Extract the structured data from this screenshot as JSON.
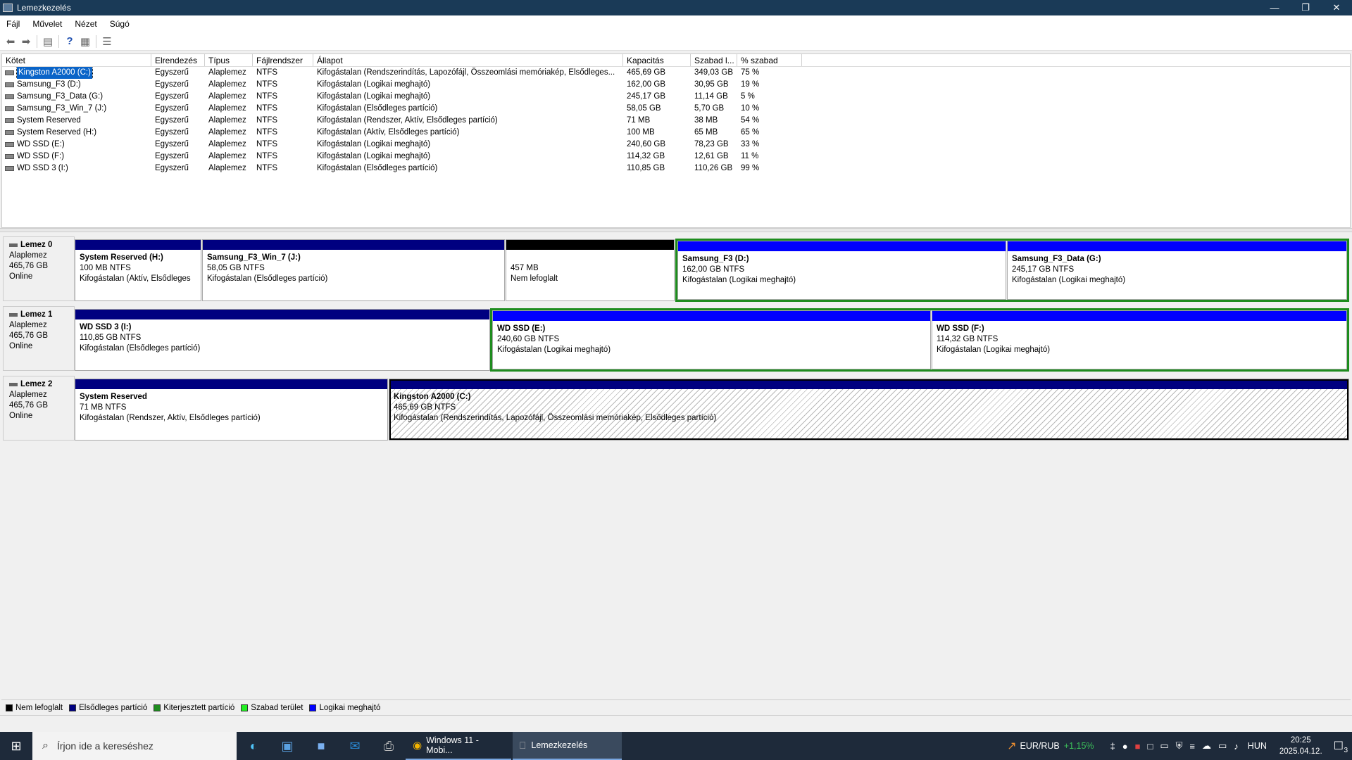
{
  "window": {
    "title": "Lemezkezelés",
    "minimize": "—",
    "restore": "❐",
    "close": "✕"
  },
  "menu": [
    "Fájl",
    "Művelet",
    "Nézet",
    "Súgó"
  ],
  "columns": [
    "Kötet",
    "Elrendezés",
    "Típus",
    "Fájlrendszer",
    "Állapot",
    "Kapacitás",
    "Szabad l...",
    "% szabad"
  ],
  "volumes": [
    [
      "Kingston A2000 (C:)",
      "Egyszerű",
      "Alaplemez",
      "NTFS",
      "Kifogástalan (Rendszerindítás, Lapozófájl, Összeomlási memóriakép, Elsődleges...",
      "465,69 GB",
      "349,03 GB",
      "75 %"
    ],
    [
      "Samsung_F3 (D:)",
      "Egyszerű",
      "Alaplemez",
      "NTFS",
      "Kifogástalan (Logikai meghajtó)",
      "162,00 GB",
      "30,95 GB",
      "19 %"
    ],
    [
      "Samsung_F3_Data (G:)",
      "Egyszerű",
      "Alaplemez",
      "NTFS",
      "Kifogástalan (Logikai meghajtó)",
      "245,17 GB",
      "11,14 GB",
      "5 %"
    ],
    [
      "Samsung_F3_Win_7 (J:)",
      "Egyszerű",
      "Alaplemez",
      "NTFS",
      "Kifogástalan (Elsődleges partíció)",
      "58,05 GB",
      "5,70 GB",
      "10 %"
    ],
    [
      "System Reserved",
      "Egyszerű",
      "Alaplemez",
      "NTFS",
      "Kifogástalan (Rendszer, Aktív, Elsődleges partíció)",
      "71 MB",
      "38 MB",
      "54 %"
    ],
    [
      "System Reserved (H:)",
      "Egyszerű",
      "Alaplemez",
      "NTFS",
      "Kifogástalan (Aktív, Elsődleges partíció)",
      "100 MB",
      "65 MB",
      "65 %"
    ],
    [
      "WD SSD (E:)",
      "Egyszerű",
      "Alaplemez",
      "NTFS",
      "Kifogástalan (Logikai meghajtó)",
      "240,60 GB",
      "78,23 GB",
      "33 %"
    ],
    [
      "WD SSD (F:)",
      "Egyszerű",
      "Alaplemez",
      "NTFS",
      "Kifogástalan (Logikai meghajtó)",
      "114,32 GB",
      "12,61 GB",
      "11 %"
    ],
    [
      "WD SSD 3 (I:)",
      "Egyszerű",
      "Alaplemez",
      "NTFS",
      "Kifogástalan (Elsődleges partíció)",
      "110,85 GB",
      "110,26 GB",
      "99 %"
    ]
  ],
  "disks": [
    {
      "name": "Lemez 0",
      "type": "Alaplemez",
      "size": "465,76 GB",
      "status": "Online",
      "parts": [
        {
          "title": "System Reserved  (H:)",
          "size": "100 MB NTFS",
          "status": "Kifogástalan (Aktív, Elsődleges"
        },
        {
          "title": "Samsung_F3_Win_7  (J:)",
          "size": "58,05 GB NTFS",
          "status": "Kifogástalan (Elsődleges partíció)"
        },
        {
          "title": "",
          "size": "457 MB",
          "status": "Nem lefoglalt"
        },
        {
          "title": "Samsung_F3  (D:)",
          "size": "162,00 GB NTFS",
          "status": "Kifogástalan (Logikai meghajtó)"
        },
        {
          "title": "Samsung_F3_Data  (G:)",
          "size": "245,17 GB NTFS",
          "status": "Kifogástalan (Logikai meghajtó)"
        }
      ]
    },
    {
      "name": "Lemez 1",
      "type": "Alaplemez",
      "size": "465,76 GB",
      "status": "Online",
      "parts": [
        {
          "title": "WD SSD 3  (I:)",
          "size": "110,85 GB NTFS",
          "status": "Kifogástalan (Elsődleges partíció)"
        },
        {
          "title": "WD SSD  (E:)",
          "size": "240,60 GB NTFS",
          "status": "Kifogástalan (Logikai meghajtó)"
        },
        {
          "title": "WD SSD  (F:)",
          "size": "114,32 GB NTFS",
          "status": "Kifogástalan (Logikai meghajtó)"
        }
      ]
    },
    {
      "name": "Lemez 2",
      "type": "Alaplemez",
      "size": "465,76 GB",
      "status": "Online",
      "parts": [
        {
          "title": "System Reserved",
          "size": "71 MB NTFS",
          "status": "Kifogástalan (Rendszer, Aktív, Elsődleges partíció)"
        },
        {
          "title": "Kingston A2000  (C:)",
          "size": "465,69 GB NTFS",
          "status": "Kifogástalan (Rendszerindítás, Lapozófájl, Összeomlási memóriakép, Elsődleges partíció)"
        }
      ]
    }
  ],
  "legend": [
    {
      "label": "Nem lefoglalt",
      "color": "#000000"
    },
    {
      "label": "Elsődleges partíció",
      "color": "#000080"
    },
    {
      "label": "Kiterjesztett partíció",
      "color": "#1e8c1e"
    },
    {
      "label": "Szabad terület",
      "color": "#22ee22"
    },
    {
      "label": "Logikai meghajtó",
      "color": "#0000ff"
    }
  ],
  "taskbar": {
    "search_placeholder": "Írjon ide a kereséshez",
    "windows": [
      "Windows 11 - Mobi...",
      "Lemezkezelés"
    ],
    "ticker_label": "EUR/RUB",
    "ticker_value": "+1,15%",
    "lang": "HUN",
    "time": "20:25",
    "date": "2025.04.12.",
    "notif_count": "3"
  },
  "colors": {
    "primary": "#000080",
    "logical": "#0000ff",
    "unallocated": "#000000",
    "extended": "#1e8c1e",
    "selection": "#0a64c8"
  }
}
